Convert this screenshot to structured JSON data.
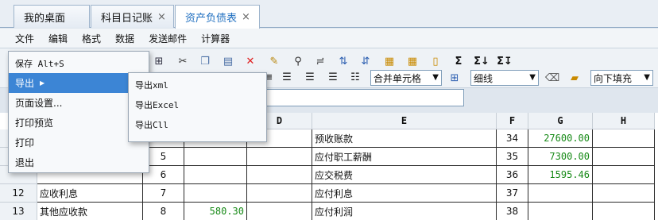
{
  "tabs": [
    {
      "label": "我的桌面"
    },
    {
      "label": "科目日记账"
    },
    {
      "label": "资产负债表"
    }
  ],
  "tab_close_glyph": "×",
  "menubar": [
    "文件",
    "编辑",
    "格式",
    "数据",
    "发送邮件",
    "计算器"
  ],
  "toolbar": {
    "merge_select": "合并单元格",
    "border_select": "细线",
    "fill_select": "向下填充"
  },
  "file_menu": {
    "items": [
      {
        "label": "保存 Alt+S"
      },
      {
        "label": "导出"
      },
      {
        "label": "页面设置..."
      },
      {
        "label": "打印预览"
      },
      {
        "label": "打印"
      },
      {
        "label": "退出"
      }
    ],
    "submenu_arrow": "▶"
  },
  "export_submenu": [
    "导出xml",
    "导出Excel",
    "导出Cll"
  ],
  "columns": [
    "D",
    "E",
    "F",
    "G",
    "H"
  ],
  "rows": [
    {
      "rownum": "",
      "a": "",
      "b": "",
      "c": "",
      "e": "预收账款",
      "f": "34",
      "g": "27600.00"
    },
    {
      "rownum": "",
      "a": "",
      "b": "5",
      "c": "",
      "e": "应付职工薪酬",
      "f": "35",
      "g": "7300.00"
    },
    {
      "rownum": "",
      "a": "",
      "b": "6",
      "c": "",
      "e": "应交税费",
      "f": "36",
      "g": "1595.46"
    },
    {
      "rownum": "12",
      "a": "应收利息",
      "b": "7",
      "c": "",
      "e": "应付利息",
      "f": "37",
      "g": ""
    },
    {
      "rownum": "13",
      "a": "其他应收款",
      "b": "8",
      "c": "580.30",
      "e": "应付利润",
      "f": "38",
      "g": ""
    }
  ]
}
